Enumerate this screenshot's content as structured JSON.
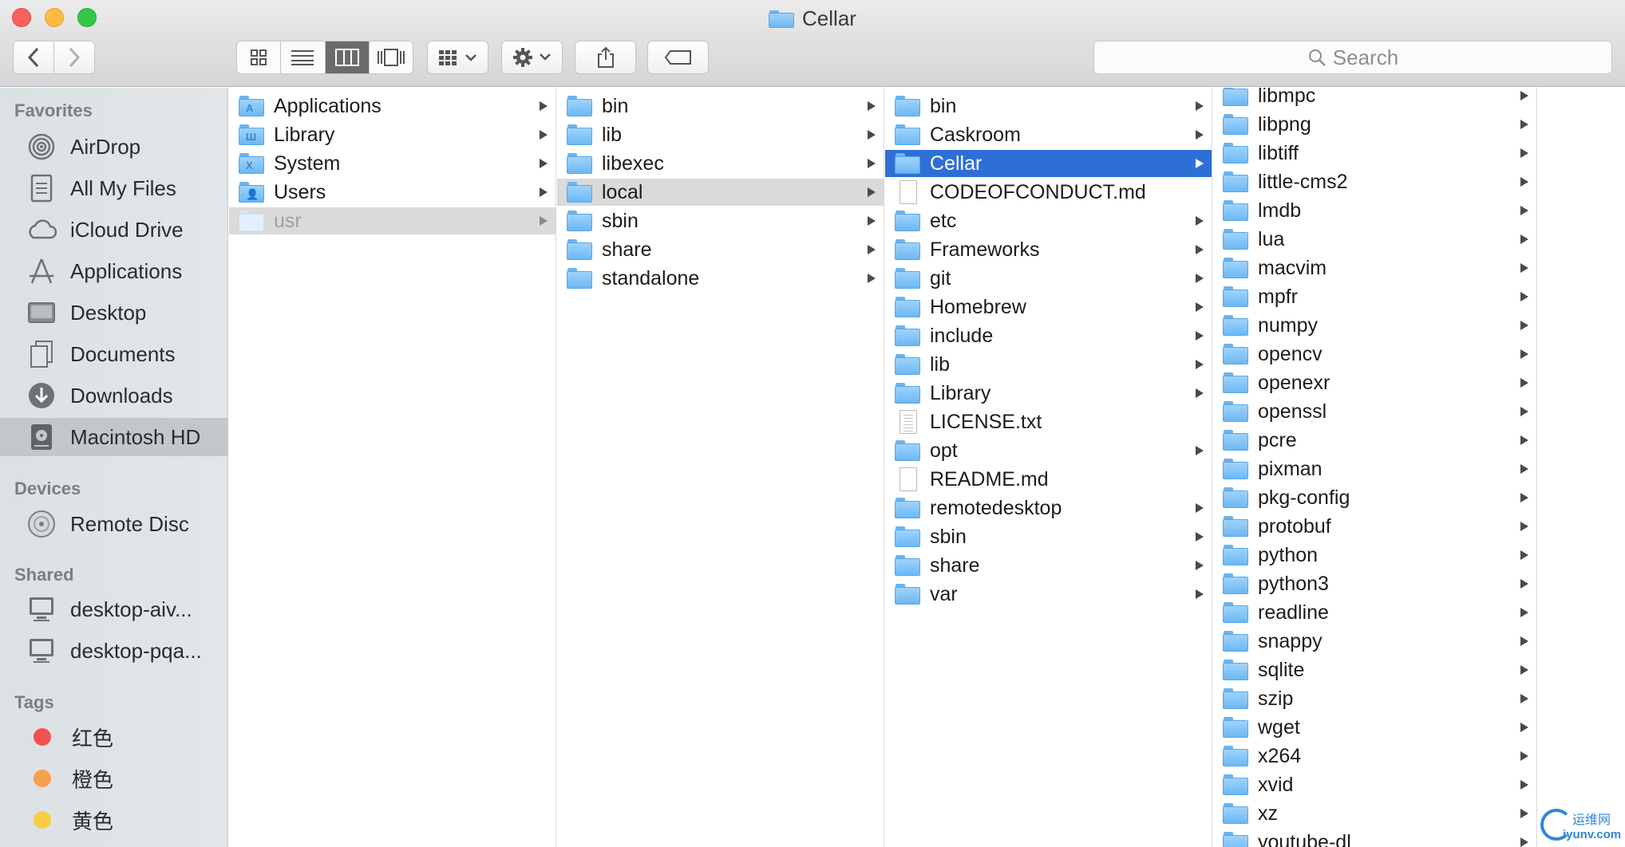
{
  "window": {
    "title": "Cellar"
  },
  "toolbar": {
    "search_placeholder": "Search",
    "back_icon": "chevron-left-icon",
    "forward_icon": "chevron-right-icon",
    "views": [
      "icon-view",
      "list-view",
      "column-view",
      "cover-flow-view"
    ],
    "active_view": "column-view"
  },
  "sidebar": {
    "favorites_header": "Favorites",
    "favorites": [
      {
        "label": "AirDrop",
        "icon": "airdrop-icon"
      },
      {
        "label": "All My Files",
        "icon": "all-files-icon"
      },
      {
        "label": "iCloud Drive",
        "icon": "cloud-icon"
      },
      {
        "label": "Applications",
        "icon": "applications-icon"
      },
      {
        "label": "Desktop",
        "icon": "desktop-icon"
      },
      {
        "label": "Documents",
        "icon": "documents-icon"
      },
      {
        "label": "Downloads",
        "icon": "downloads-icon"
      },
      {
        "label": "Macintosh HD",
        "icon": "hard-drive-icon",
        "selected": true
      }
    ],
    "devices_header": "Devices",
    "devices": [
      {
        "label": "Remote Disc",
        "icon": "disc-icon"
      }
    ],
    "shared_header": "Shared",
    "shared": [
      {
        "label": "desktop-aiv...",
        "icon": "computer-icon"
      },
      {
        "label": "desktop-pqa...",
        "icon": "computer-icon"
      }
    ],
    "tags_header": "Tags",
    "tags": [
      {
        "label": "红色",
        "color": "#f2534f"
      },
      {
        "label": "橙色",
        "color": "#f5a04a"
      },
      {
        "label": "黄色",
        "color": "#f7cd47"
      }
    ]
  },
  "columns": [
    {
      "items": [
        {
          "name": "Applications",
          "kind": "folder",
          "mark": "A",
          "arrow": true
        },
        {
          "name": "Library",
          "kind": "folder",
          "mark": "Ш",
          "arrow": true
        },
        {
          "name": "System",
          "kind": "folder",
          "mark": "X",
          "arrow": true
        },
        {
          "name": "Users",
          "kind": "folder",
          "mark": "👤",
          "arrow": true
        },
        {
          "name": "usr",
          "kind": "folder-pale",
          "arrow": true,
          "selected": "inactive",
          "dim": true
        }
      ]
    },
    {
      "items": [
        {
          "name": "bin",
          "kind": "folder",
          "arrow": true
        },
        {
          "name": "lib",
          "kind": "folder",
          "arrow": true
        },
        {
          "name": "libexec",
          "kind": "folder",
          "arrow": true
        },
        {
          "name": "local",
          "kind": "folder",
          "arrow": true,
          "selected": "inactive"
        },
        {
          "name": "sbin",
          "kind": "folder",
          "arrow": true
        },
        {
          "name": "share",
          "kind": "folder",
          "arrow": true
        },
        {
          "name": "standalone",
          "kind": "folder",
          "arrow": true
        }
      ]
    },
    {
      "items": [
        {
          "name": "bin",
          "kind": "folder",
          "arrow": true
        },
        {
          "name": "Caskroom",
          "kind": "folder",
          "arrow": true
        },
        {
          "name": "Cellar",
          "kind": "folder",
          "arrow": true,
          "selected": "active"
        },
        {
          "name": "CODEOFCONDUCT.md",
          "kind": "doc",
          "arrow": false
        },
        {
          "name": "etc",
          "kind": "folder",
          "arrow": true
        },
        {
          "name": "Frameworks",
          "kind": "folder",
          "arrow": true
        },
        {
          "name": "git",
          "kind": "folder",
          "arrow": true
        },
        {
          "name": "Homebrew",
          "kind": "folder",
          "arrow": true
        },
        {
          "name": "include",
          "kind": "folder",
          "arrow": true
        },
        {
          "name": "lib",
          "kind": "folder",
          "arrow": true
        },
        {
          "name": "Library",
          "kind": "folder",
          "arrow": true
        },
        {
          "name": "LICENSE.txt",
          "kind": "doc-text",
          "arrow": false
        },
        {
          "name": "opt",
          "kind": "folder",
          "arrow": true
        },
        {
          "name": "README.md",
          "kind": "doc",
          "arrow": false
        },
        {
          "name": "remotedesktop",
          "kind": "folder",
          "arrow": true
        },
        {
          "name": "sbin",
          "kind": "folder",
          "arrow": true
        },
        {
          "name": "share",
          "kind": "folder",
          "arrow": true
        },
        {
          "name": "var",
          "kind": "folder",
          "arrow": true
        }
      ]
    },
    {
      "items": [
        {
          "name": "libmpc",
          "kind": "folder",
          "arrow": true
        },
        {
          "name": "libpng",
          "kind": "folder",
          "arrow": true
        },
        {
          "name": "libtiff",
          "kind": "folder",
          "arrow": true
        },
        {
          "name": "little-cms2",
          "kind": "folder",
          "arrow": true
        },
        {
          "name": "lmdb",
          "kind": "folder",
          "arrow": true
        },
        {
          "name": "lua",
          "kind": "folder",
          "arrow": true
        },
        {
          "name": "macvim",
          "kind": "folder",
          "arrow": true
        },
        {
          "name": "mpfr",
          "kind": "folder",
          "arrow": true
        },
        {
          "name": "numpy",
          "kind": "folder",
          "arrow": true
        },
        {
          "name": "opencv",
          "kind": "folder",
          "arrow": true
        },
        {
          "name": "openexr",
          "kind": "folder",
          "arrow": true
        },
        {
          "name": "openssl",
          "kind": "folder",
          "arrow": true
        },
        {
          "name": "pcre",
          "kind": "folder",
          "arrow": true
        },
        {
          "name": "pixman",
          "kind": "folder",
          "arrow": true
        },
        {
          "name": "pkg-config",
          "kind": "folder",
          "arrow": true
        },
        {
          "name": "protobuf",
          "kind": "folder",
          "arrow": true
        },
        {
          "name": "python",
          "kind": "folder",
          "arrow": true
        },
        {
          "name": "python3",
          "kind": "folder",
          "arrow": true
        },
        {
          "name": "readline",
          "kind": "folder",
          "arrow": true
        },
        {
          "name": "snappy",
          "kind": "folder",
          "arrow": true
        },
        {
          "name": "sqlite",
          "kind": "folder",
          "arrow": true
        },
        {
          "name": "szip",
          "kind": "folder",
          "arrow": true
        },
        {
          "name": "wget",
          "kind": "folder",
          "arrow": true
        },
        {
          "name": "x264",
          "kind": "folder",
          "arrow": true
        },
        {
          "name": "xvid",
          "kind": "folder",
          "arrow": true
        },
        {
          "name": "xz",
          "kind": "folder",
          "arrow": true
        },
        {
          "name": "youtube-dl",
          "kind": "folder",
          "arrow": true
        }
      ]
    }
  ],
  "watermark": {
    "cn": "运维网",
    "en": "iyunv.com"
  }
}
